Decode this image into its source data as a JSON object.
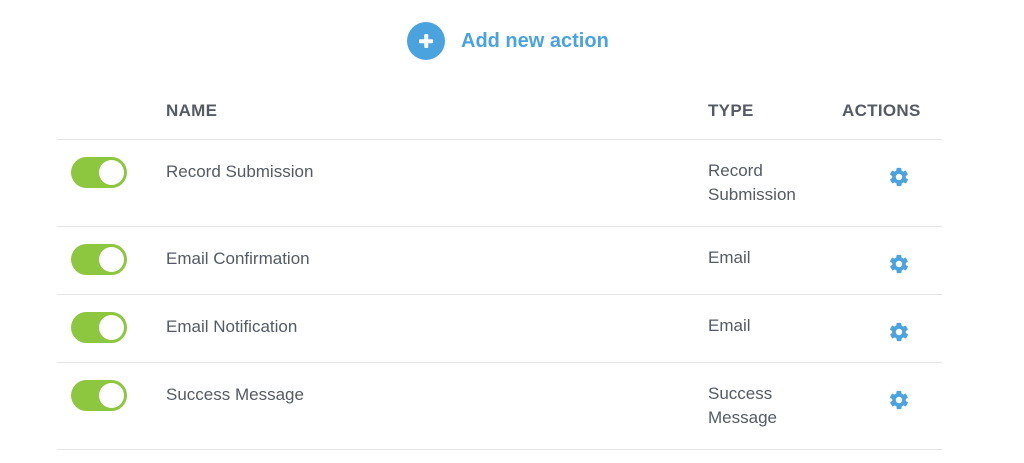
{
  "header": {
    "add_action_label": "Add new action",
    "add_icon": "plus-circle-icon"
  },
  "table": {
    "columns": {
      "name": "NAME",
      "type": "TYPE",
      "actions": "ACTIONS"
    },
    "rows": [
      {
        "enabled": true,
        "name": "Record Submission",
        "type": "Record Submission"
      },
      {
        "enabled": true,
        "name": "Email Confirmation",
        "type": "Email"
      },
      {
        "enabled": true,
        "name": "Email Notification",
        "type": "Email"
      },
      {
        "enabled": true,
        "name": "Success Message",
        "type": "Success Message"
      }
    ],
    "action_icon": "gear-icon"
  },
  "colors": {
    "accent": "#4aa3df",
    "toggle_on": "#8dc63f",
    "text": "#545b64",
    "divider": "#e3e5e8"
  }
}
